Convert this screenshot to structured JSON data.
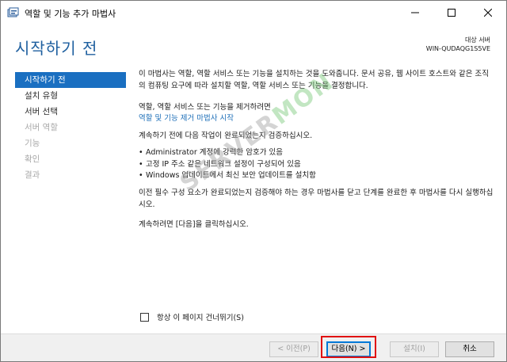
{
  "window": {
    "title": "역할 및 기능 추가 마법사"
  },
  "header": {
    "page_title": "시작하기 전",
    "destination_label": "대상 서버",
    "destination_value": "WIN-QUDAQG1S5VE"
  },
  "nav": {
    "items": [
      {
        "label": "시작하기 전",
        "state": "active"
      },
      {
        "label": "설치 유형",
        "state": "enabled"
      },
      {
        "label": "서버 선택",
        "state": "enabled"
      },
      {
        "label": "서버 역할",
        "state": "disabled"
      },
      {
        "label": "기능",
        "state": "disabled"
      },
      {
        "label": "확인",
        "state": "disabled"
      },
      {
        "label": "결과",
        "state": "disabled"
      }
    ]
  },
  "content": {
    "intro": "이 마법사는 역할, 역할 서비스 또는 기능을 설치하는 것을 도와줍니다. 문서 공유, 웹 사이트 호스트와 같은 조직의 컴퓨팅 요구에 따라 설치할 역할, 역할 서비스 또는 기능을 결정합니다.",
    "remove_text": "역할, 역할 서비스 또는 기능을 제거하려면",
    "remove_link": "역할 및 기능 제거 마법사 시작",
    "check_text": "계속하기 전에 다음 작업이 완료되었는지 검증하십시오.",
    "bullets": [
      "Administrator 계정에 강력한 암호가 있음",
      "고정 IP 주소 같은 네트워크 설정이 구성되어 있음",
      "Windows 업데이트에서 최신 보안 업데이트를 설치함"
    ],
    "prereq_text": "이전 필수 구성 요소가 완료되었는지 검증해야 하는 경우 마법사를 닫고 단계를 완료한 후 마법사를 다시 실행하십시오.",
    "continue_text": "계속하려면 [다음]을 클릭하십시오."
  },
  "skip": {
    "label": "항상 이 페이지 건너뛰기(S)",
    "checked": false
  },
  "footer": {
    "prev_label": "< 이전(P)",
    "next_label": "다음(N) >",
    "install_label": "설치(I)",
    "cancel_label": "취소"
  },
  "watermark": {
    "text_a": "SERVER",
    "text_b": "MON"
  },
  "colors": {
    "accent": "#1a6fc1",
    "title": "#1e5f9f",
    "link": "#1e6fb8",
    "highlight": "#e01010"
  }
}
